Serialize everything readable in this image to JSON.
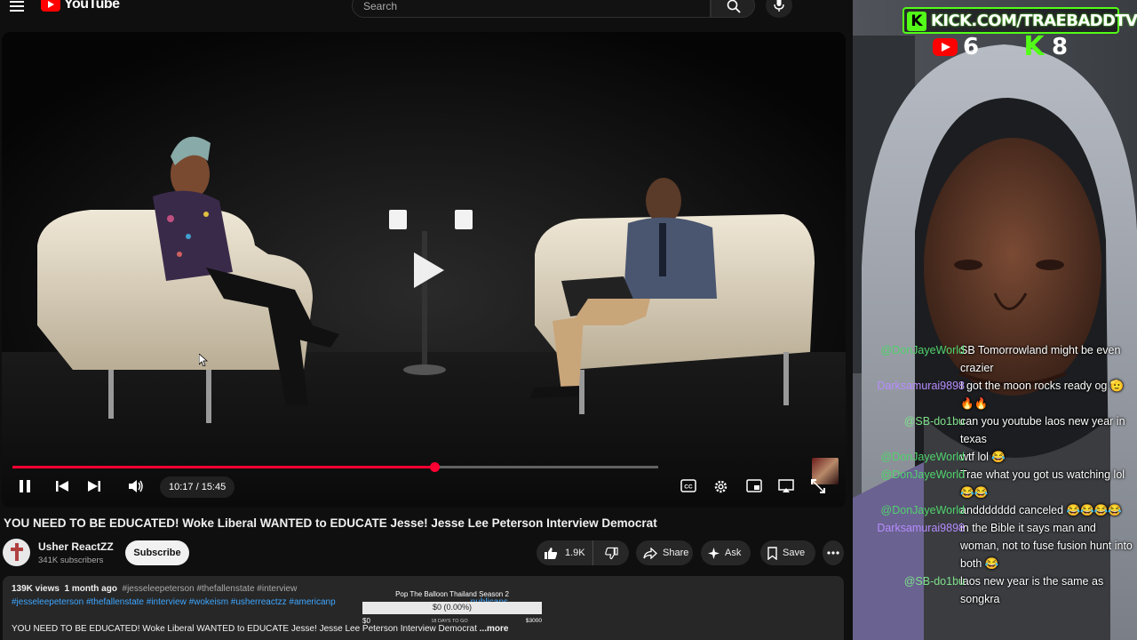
{
  "youtube": {
    "logo_text": "YouTube",
    "search_placeholder": "Search",
    "player": {
      "current_time": "10:17",
      "duration": "15:45",
      "time_display": "10:17 / 15:45",
      "played_fraction": 0.653,
      "buffered_fraction": 1.0
    },
    "video_title": "YOU NEED TO BE EDUCATED! Woke Liberal WANTED to EDUCATE Jesse! Jesse Lee Peterson Interview Democrat",
    "channel": {
      "name": "Usher ReactZZ",
      "subscribers": "341K subscribers",
      "subscribe_label": "Subscribe"
    },
    "actions": {
      "likes": "1.9K",
      "share": "Share",
      "ask": "Ask",
      "save": "Save"
    },
    "description": {
      "views": "139K views",
      "age": "1 month ago",
      "inline_tags": "#jesseleepeterson #thefallenstate #interview",
      "tags_line": "#jesseleepeterson #thefallenstate #interview #wokeism #usherreactzz #americanp",
      "tags_tail": "publicans",
      "text": "YOU NEED TO BE EDUCATED! Woke Liberal WANTED to EDUCATE Jesse! Jesse Lee Peterson Interview Democrat",
      "more": "...more"
    },
    "balloon": {
      "title": "Pop The Balloon Thailand Season 2",
      "amount": "$0 (0.00%)",
      "min": "$0",
      "days": "18 DAYS TO GO",
      "max": "$3000",
      "progress_fraction": 0.0
    }
  },
  "stream": {
    "banner_url": "KICK.COM/TRAEBADDTV",
    "kick_logo_letter": "K",
    "youtube_viewers": "6",
    "kick_viewers": "8",
    "colors": {
      "kick_green": "#53fc18",
      "youtube_red": "#ff0000"
    },
    "chat": [
      {
        "user": "@DonJayeWorld",
        "text": "SB Tomorrowland might be even crazier",
        "color": "green"
      },
      {
        "user": "Darksamurai9898",
        "text": "I got the moon rocks ready og 🫡🔥🔥",
        "color": "purple"
      },
      {
        "user": "@SB-do1bu",
        "text": "can you youtube laos new year in texas",
        "color": "lightgreen"
      },
      {
        "user": "@DonJayeWorld",
        "text": "wtf lol 😂",
        "color": "green"
      },
      {
        "user": "@DonJayeWorld",
        "text": "Trae what you got us watching lol 😂😂",
        "color": "green"
      },
      {
        "user": "@DonJayeWorld",
        "text": "anddddddd canceled 😂😂😂😂",
        "color": "green"
      },
      {
        "user": "Darksamurai9898",
        "text": "in the Bible it says man and woman, not to fuse fusion hunt into both 😂",
        "color": "purple"
      },
      {
        "user": "@SB-do1bu",
        "text": "laos new year is the same as songkra",
        "color": "lightgreen"
      }
    ]
  }
}
